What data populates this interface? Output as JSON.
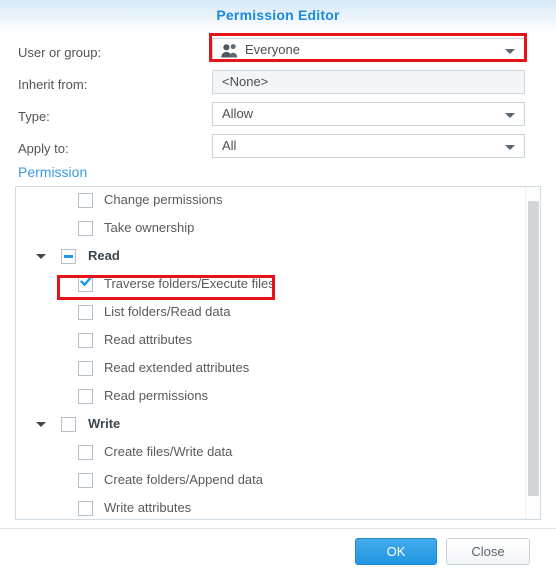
{
  "dialog": {
    "title": "Permission Editor"
  },
  "form": {
    "rows": [
      {
        "label": "User or group:",
        "value": "Everyone",
        "icon": "group-icon",
        "type": "dropdown",
        "readonly": false,
        "highlighted": true
      },
      {
        "label": "Inherit from:",
        "value": "<None>",
        "icon": "",
        "type": "text",
        "readonly": true,
        "highlighted": false
      },
      {
        "label": "Type:",
        "value": "Allow",
        "icon": "",
        "type": "dropdown",
        "readonly": false,
        "highlighted": false
      },
      {
        "label": "Apply to:",
        "value": "All",
        "icon": "",
        "type": "dropdown",
        "readonly": false,
        "highlighted": false
      }
    ]
  },
  "permission": {
    "section_title": "Permission",
    "items": [
      {
        "label": "Change permissions",
        "level": "child",
        "state": "unchecked",
        "expander": false,
        "highlighted": false
      },
      {
        "label": "Take ownership",
        "level": "child",
        "state": "unchecked",
        "expander": false,
        "highlighted": false
      },
      {
        "label": "Read",
        "level": "parent",
        "state": "indeterminate",
        "expander": true,
        "highlighted": false
      },
      {
        "label": "Traverse folders/Execute files",
        "level": "child",
        "state": "checked",
        "expander": false,
        "highlighted": true
      },
      {
        "label": "List folders/Read data",
        "level": "child",
        "state": "unchecked",
        "expander": false,
        "highlighted": false
      },
      {
        "label": "Read attributes",
        "level": "child",
        "state": "unchecked",
        "expander": false,
        "highlighted": false
      },
      {
        "label": "Read extended attributes",
        "level": "child",
        "state": "unchecked",
        "expander": false,
        "highlighted": false
      },
      {
        "label": "Read permissions",
        "level": "child",
        "state": "unchecked",
        "expander": false,
        "highlighted": false
      },
      {
        "label": "Write",
        "level": "parent",
        "state": "unchecked",
        "expander": true,
        "highlighted": false
      },
      {
        "label": "Create files/Write data",
        "level": "child",
        "state": "unchecked",
        "expander": false,
        "highlighted": false
      },
      {
        "label": "Create folders/Append data",
        "level": "child",
        "state": "unchecked",
        "expander": false,
        "highlighted": false
      },
      {
        "label": "Write attributes",
        "level": "child",
        "state": "unchecked",
        "expander": false,
        "highlighted": false
      }
    ]
  },
  "footer": {
    "ok_label": "OK",
    "close_label": "Close"
  },
  "colors": {
    "accent": "#1a8ae0",
    "highlight": "#e5141b",
    "checkbox_blue": "#1f9ae8",
    "primary_button": "#2196e2"
  }
}
